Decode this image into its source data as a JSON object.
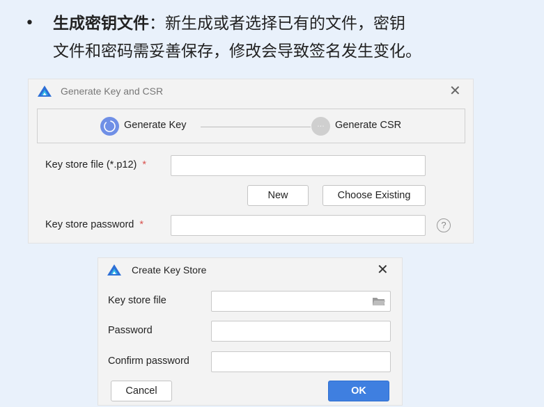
{
  "slide": {
    "bullet": "•",
    "term": "生成密钥文件",
    "line1_rest": "：新生成或者选择已有的文件，密钥",
    "line2": "文件和密码需妥善保存，修改会导致签名发生变化。"
  },
  "generate_dialog": {
    "title": "Generate Key and CSR",
    "steps": [
      {
        "label": "Generate Key",
        "state": "active"
      },
      {
        "label": "Generate CSR",
        "state": "pending"
      }
    ],
    "key_store_file_label": "Key store file (*.p12)",
    "key_store_file_value": "",
    "required_mark": "*",
    "new_button": "New",
    "choose_existing_button": "Choose Existing",
    "key_store_password_label": "Key store password",
    "key_store_password_value": "",
    "help_glyph": "?"
  },
  "create_dialog": {
    "title": "Create Key Store",
    "key_store_file_label": "Key store file",
    "key_store_file_value": "",
    "password_label": "Password",
    "password_value": "",
    "confirm_password_label": "Confirm password",
    "confirm_password_value": "",
    "cancel_button": "Cancel",
    "ok_button": "OK"
  },
  "colors": {
    "background": "#e9f1fb",
    "dialog_bg": "#f3f3f3",
    "primary": "#3f7fe0",
    "active_step": "#6f8fe6",
    "pending_step": "#cfcfcf",
    "required": "#d9534f",
    "app_icon_blue": "#2d6fd6",
    "app_icon_cyan": "#33b7e8"
  },
  "icons": {
    "app": "app-logo-icon",
    "close": "close-icon",
    "folder": "folder-icon",
    "help": "help-icon"
  }
}
